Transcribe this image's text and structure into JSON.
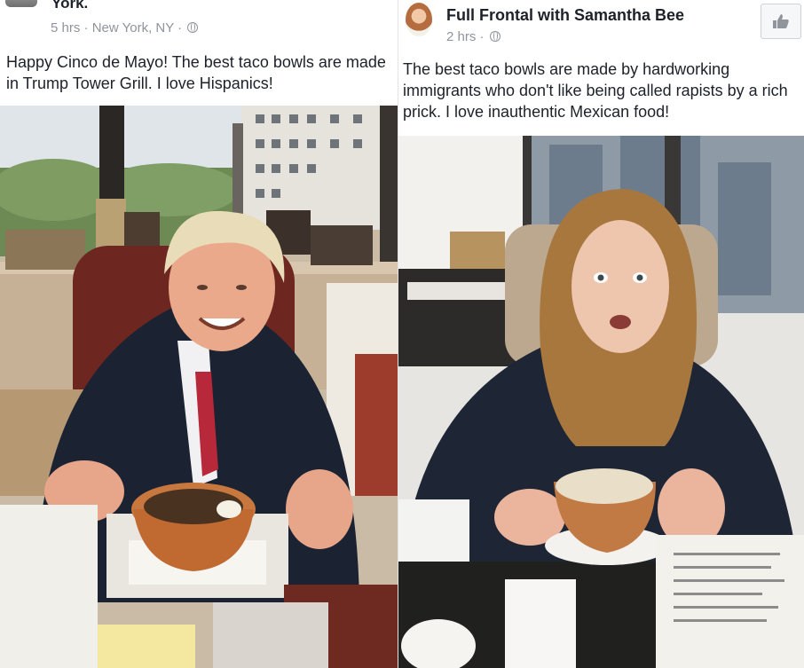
{
  "left_post": {
    "author_fragment": "York.",
    "time": "5 hrs",
    "location": "New York, NY",
    "separator": "·",
    "text": "Happy Cinco de Mayo! The best taco bowls are made in Trump Tower Grill. I love Hispanics!",
    "icons": {
      "privacy": "globe-icon"
    }
  },
  "right_post": {
    "page_name": "Full Frontal with Samantha Bee",
    "time": "2 hrs",
    "separator": "·",
    "text": "The best taco bowls are made by hardworking immigrants who don't like being called rapists by a rich prick. I love inauthentic Mexican food!",
    "icons": {
      "privacy": "globe-icon",
      "like": "thumbs-up-icon"
    }
  },
  "colors": {
    "text": "#1d2129",
    "meta": "#90949c",
    "background": "#ffffff"
  }
}
